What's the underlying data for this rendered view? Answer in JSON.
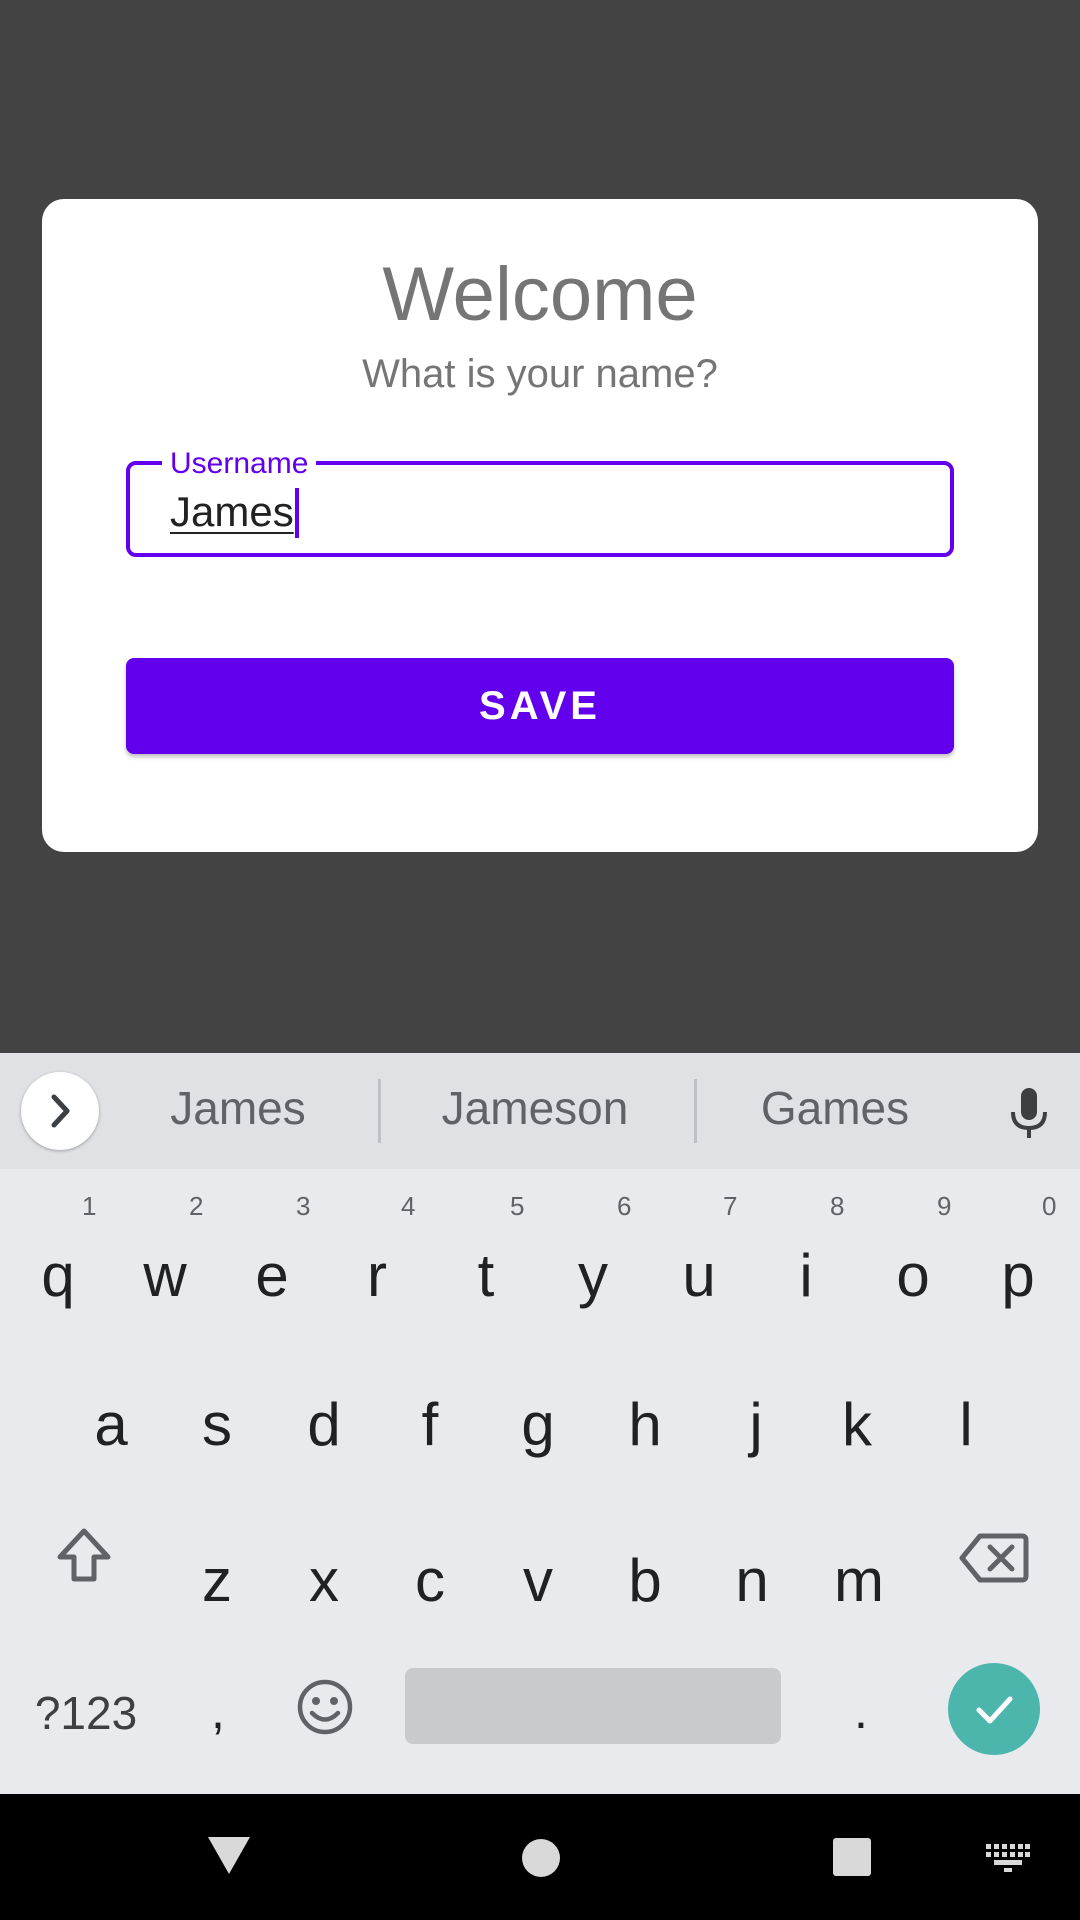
{
  "dialog": {
    "title": "Welcome",
    "subtitle": "What is your name?",
    "field": {
      "label": "Username",
      "value": "James"
    },
    "save_label": "SAVE"
  },
  "keyboard": {
    "suggestions": [
      "James",
      "Jameson",
      "Games"
    ],
    "row1": [
      {
        "key": "q",
        "num": "1"
      },
      {
        "key": "w",
        "num": "2"
      },
      {
        "key": "e",
        "num": "3"
      },
      {
        "key": "r",
        "num": "4"
      },
      {
        "key": "t",
        "num": "5"
      },
      {
        "key": "y",
        "num": "6"
      },
      {
        "key": "u",
        "num": "7"
      },
      {
        "key": "i",
        "num": "8"
      },
      {
        "key": "o",
        "num": "9"
      },
      {
        "key": "p",
        "num": "0"
      }
    ],
    "row2": [
      "a",
      "s",
      "d",
      "f",
      "g",
      "h",
      "j",
      "k",
      "l"
    ],
    "row3": [
      "z",
      "x",
      "c",
      "v",
      "b",
      "n",
      "m"
    ],
    "symbols_label": "?123",
    "comma": ",",
    "period": "."
  },
  "colors": {
    "accent": "#6200EE",
    "scrim": "#434343",
    "enter_key": "#4DB6AC",
    "keyboard_bg": "#E8EAED"
  },
  "icons": {
    "expand": "chevron-right-icon",
    "mic": "microphone-icon",
    "shift": "shift-icon",
    "backspace": "backspace-icon",
    "emoji": "emoji-icon",
    "enter": "check-icon",
    "nav_back": "back-triangle-icon",
    "nav_home": "home-circle-icon",
    "nav_recents": "recents-square-icon",
    "nav_keyboard": "keyboard-switch-icon"
  }
}
